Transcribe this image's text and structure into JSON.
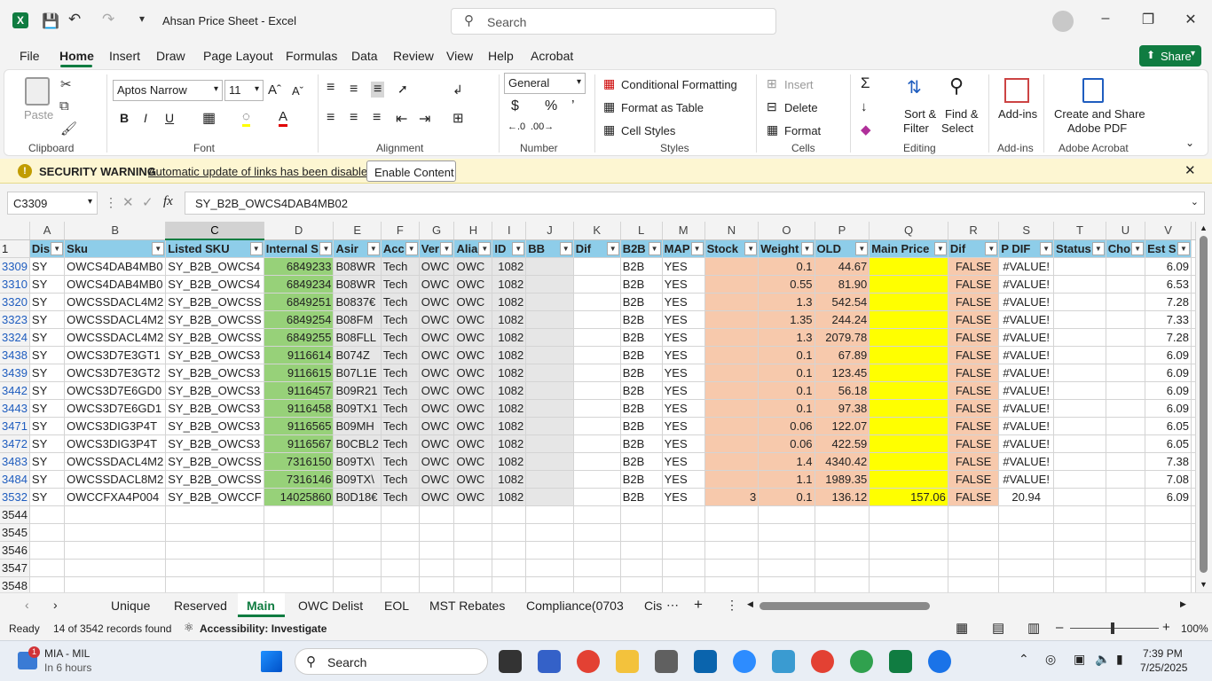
{
  "titlebar": {
    "title": "Ahsan Price Sheet  -  Excel",
    "search_placeholder": "Search"
  },
  "menu": [
    "File",
    "Home",
    "Insert",
    "Draw",
    "Page Layout",
    "Formulas",
    "Data",
    "Review",
    "View",
    "Help",
    "Acrobat"
  ],
  "share_label": "Share",
  "ribbon": {
    "clipboard": {
      "paste": "Paste",
      "label": "Clipboard"
    },
    "font": {
      "name": "Aptos Narrow",
      "size": "11",
      "label": "Font"
    },
    "alignment": {
      "label": "Alignment"
    },
    "number": {
      "format": "General",
      "label": "Number"
    },
    "styles": {
      "conditional": "Conditional Formatting",
      "format_table": "Format as Table",
      "cell_styles": "Cell Styles",
      "label": "Styles"
    },
    "cells": {
      "insert": "Insert",
      "delete": "Delete",
      "format": "Format",
      "label": "Cells"
    },
    "editing": {
      "sort1": "Sort &",
      "sort2": "Filter",
      "find1": "Find &",
      "find2": "Select",
      "label": "Editing"
    },
    "addins": {
      "addins": "Add-ins",
      "label": "Add-ins"
    },
    "acrobat": {
      "create1": "Create and Share",
      "create2": "Adobe PDF",
      "label": "Adobe Acrobat"
    }
  },
  "security": {
    "title": "SECURITY WARNING",
    "message": "Automatic update of links has been disabled",
    "button": "Enable Content"
  },
  "formula": {
    "namebox": "C3309",
    "fx": "fx",
    "value": "SY_B2B_OWCS4DAB4MB02"
  },
  "columns": [
    "A",
    "B",
    "C",
    "D",
    "E",
    "F",
    "G",
    "H",
    "I",
    "J",
    "K",
    "L",
    "M",
    "N",
    "O",
    "P",
    "Q",
    "R",
    "S",
    "T",
    "U",
    "V"
  ],
  "header_row_num": "1",
  "headers": [
    "Dis",
    "Sku",
    "Listed SKU",
    "Internal S",
    "Asir",
    "Acc",
    "Ver",
    "Alia",
    "ID",
    "BB",
    "Dif",
    "B2B",
    "MAP",
    "Stock",
    "Weight",
    "OLD",
    "Main Price",
    "Dif",
    "P DIF",
    "Status",
    "Cho",
    "Est S"
  ],
  "rows": [
    {
      "n": "3309",
      "dis": "SY",
      "sku": "OWCS4DAB4MB0",
      "lsku": "SY_B2B_OWCS4",
      "isku": "6849233",
      "asin": "B08WR",
      "acc": "Tech",
      "ver": "OWC",
      "alia": "OWC",
      "id": "1082",
      "b2b": "B2B",
      "map": "YES",
      "stock": "",
      "weight": "0.1",
      "old": "44.67",
      "price": "",
      "dif": "FALSE",
      "pdif": "#VALUE!",
      "est": "6.09"
    },
    {
      "n": "3310",
      "dis": "SY",
      "sku": "OWCS4DAB4MB0",
      "lsku": "SY_B2B_OWCS4",
      "isku": "6849234",
      "asin": "B08WR",
      "acc": "Tech",
      "ver": "OWC",
      "alia": "OWC",
      "id": "1082",
      "b2b": "B2B",
      "map": "YES",
      "stock": "",
      "weight": "0.55",
      "old": "81.90",
      "price": "",
      "dif": "FALSE",
      "pdif": "#VALUE!",
      "est": "6.53"
    },
    {
      "n": "3320",
      "dis": "SY",
      "sku": "OWCSSDACL4M2",
      "lsku": "SY_B2B_OWCSS",
      "isku": "6849251",
      "asin": "B0837€",
      "acc": "Tech",
      "ver": "OWC",
      "alia": "OWC",
      "id": "1082",
      "b2b": "B2B",
      "map": "YES",
      "stock": "",
      "weight": "1.3",
      "old": "542.54",
      "price": "",
      "dif": "FALSE",
      "pdif": "#VALUE!",
      "est": "7.28"
    },
    {
      "n": "3323",
      "dis": "SY",
      "sku": "OWCSSDACL4M2",
      "lsku": "SY_B2B_OWCSS",
      "isku": "6849254",
      "asin": "B08FM",
      "acc": "Tech",
      "ver": "OWC",
      "alia": "OWC",
      "id": "1082",
      "b2b": "B2B",
      "map": "YES",
      "stock": "",
      "weight": "1.35",
      "old": "244.24",
      "price": "",
      "dif": "FALSE",
      "pdif": "#VALUE!",
      "est": "7.33"
    },
    {
      "n": "3324",
      "dis": "SY",
      "sku": "OWCSSDACL4M2",
      "lsku": "SY_B2B_OWCSS",
      "isku": "6849255",
      "asin": "B08FLL",
      "acc": "Tech",
      "ver": "OWC",
      "alia": "OWC",
      "id": "1082",
      "b2b": "B2B",
      "map": "YES",
      "stock": "",
      "weight": "1.3",
      "old": "2079.78",
      "price": "",
      "dif": "FALSE",
      "pdif": "#VALUE!",
      "est": "7.28"
    },
    {
      "n": "3438",
      "dis": "SY",
      "sku": "OWCS3D7E3GT1",
      "lsku": "SY_B2B_OWCS3",
      "isku": "9116614",
      "asin": "B074Z",
      "acc": "Tech",
      "ver": "OWC",
      "alia": "OWC",
      "id": "1082",
      "b2b": "B2B",
      "map": "YES",
      "stock": "",
      "weight": "0.1",
      "old": "67.89",
      "price": "",
      "dif": "FALSE",
      "pdif": "#VALUE!",
      "est": "6.09"
    },
    {
      "n": "3439",
      "dis": "SY",
      "sku": "OWCS3D7E3GT2",
      "lsku": "SY_B2B_OWCS3",
      "isku": "9116615",
      "asin": "B07L1E",
      "acc": "Tech",
      "ver": "OWC",
      "alia": "OWC",
      "id": "1082",
      "b2b": "B2B",
      "map": "YES",
      "stock": "",
      "weight": "0.1",
      "old": "123.45",
      "price": "",
      "dif": "FALSE",
      "pdif": "#VALUE!",
      "est": "6.09"
    },
    {
      "n": "3442",
      "dis": "SY",
      "sku": "OWCS3D7E6GD0",
      "lsku": "SY_B2B_OWCS3",
      "isku": "9116457",
      "asin": "B09R21",
      "acc": "Tech",
      "ver": "OWC",
      "alia": "OWC",
      "id": "1082",
      "b2b": "B2B",
      "map": "YES",
      "stock": "",
      "weight": "0.1",
      "old": "56.18",
      "price": "",
      "dif": "FALSE",
      "pdif": "#VALUE!",
      "est": "6.09"
    },
    {
      "n": "3443",
      "dis": "SY",
      "sku": "OWCS3D7E6GD1",
      "lsku": "SY_B2B_OWCS3",
      "isku": "9116458",
      "asin": "B09TX1",
      "acc": "Tech",
      "ver": "OWC",
      "alia": "OWC",
      "id": "1082",
      "b2b": "B2B",
      "map": "YES",
      "stock": "",
      "weight": "0.1",
      "old": "97.38",
      "price": "",
      "dif": "FALSE",
      "pdif": "#VALUE!",
      "est": "6.09"
    },
    {
      "n": "3471",
      "dis": "SY",
      "sku": "OWCS3DIG3P4T",
      "lsku": "SY_B2B_OWCS3",
      "isku": "9116565",
      "asin": "B09MH",
      "acc": "Tech",
      "ver": "OWC",
      "alia": "OWC",
      "id": "1082",
      "b2b": "B2B",
      "map": "YES",
      "stock": "",
      "weight": "0.06",
      "old": "122.07",
      "price": "",
      "dif": "FALSE",
      "pdif": "#VALUE!",
      "est": "6.05"
    },
    {
      "n": "3472",
      "dis": "SY",
      "sku": "OWCS3DIG3P4T",
      "lsku": "SY_B2B_OWCS3",
      "isku": "9116567",
      "asin": "B0CBL2",
      "acc": "Tech",
      "ver": "OWC",
      "alia": "OWC",
      "id": "1082",
      "b2b": "B2B",
      "map": "YES",
      "stock": "",
      "weight": "0.06",
      "old": "422.59",
      "price": "",
      "dif": "FALSE",
      "pdif": "#VALUE!",
      "est": "6.05"
    },
    {
      "n": "3483",
      "dis": "SY",
      "sku": "OWCSSDACL4M2",
      "lsku": "SY_B2B_OWCSS",
      "isku": "7316150",
      "asin": "B09TX\\",
      "acc": "Tech",
      "ver": "OWC",
      "alia": "OWC",
      "id": "1082",
      "b2b": "B2B",
      "map": "YES",
      "stock": "",
      "weight": "1.4",
      "old": "4340.42",
      "price": "",
      "dif": "FALSE",
      "pdif": "#VALUE!",
      "est": "7.38"
    },
    {
      "n": "3484",
      "dis": "SY",
      "sku": "OWCSSDACL8M2",
      "lsku": "SY_B2B_OWCSS",
      "isku": "7316146",
      "asin": "B09TX\\",
      "acc": "Tech",
      "ver": "OWC",
      "alia": "OWC",
      "id": "1082",
      "b2b": "B2B",
      "map": "YES",
      "stock": "",
      "weight": "1.1",
      "old": "1989.35",
      "price": "",
      "dif": "FALSE",
      "pdif": "#VALUE!",
      "est": "7.08"
    },
    {
      "n": "3532",
      "dis": "SY",
      "sku": "OWCCFXA4P004",
      "lsku": "SY_B2B_OWCCF",
      "isku": "14025860",
      "asin": "B0D18€",
      "acc": "Tech",
      "ver": "OWC",
      "alia": "OWC",
      "id": "1082",
      "b2b": "B2B",
      "map": "YES",
      "stock": "3",
      "weight": "0.1",
      "old": "136.12",
      "price": "157.06",
      "dif": "FALSE",
      "pdif": "20.94",
      "est": "6.09"
    }
  ],
  "empty_rows": [
    "3544",
    "3545",
    "3546",
    "3547",
    "3548"
  ],
  "sheets": [
    "Unique",
    "Reserved",
    "Main",
    "OWC Delist",
    "EOL",
    "MST Rebates",
    "Compliance(0703",
    "Cis"
  ],
  "active_sheet": "Main",
  "status": {
    "ready": "Ready",
    "records": "14 of 3542 records found",
    "accessibility": "Accessibility: Investigate",
    "zoom": "100%"
  },
  "taskbar": {
    "weather_title": "MIA - MIL",
    "weather_sub": "In 6 hours",
    "search": "Search",
    "time": "7:39 PM",
    "date": "7/25/2025",
    "badge": "1"
  }
}
